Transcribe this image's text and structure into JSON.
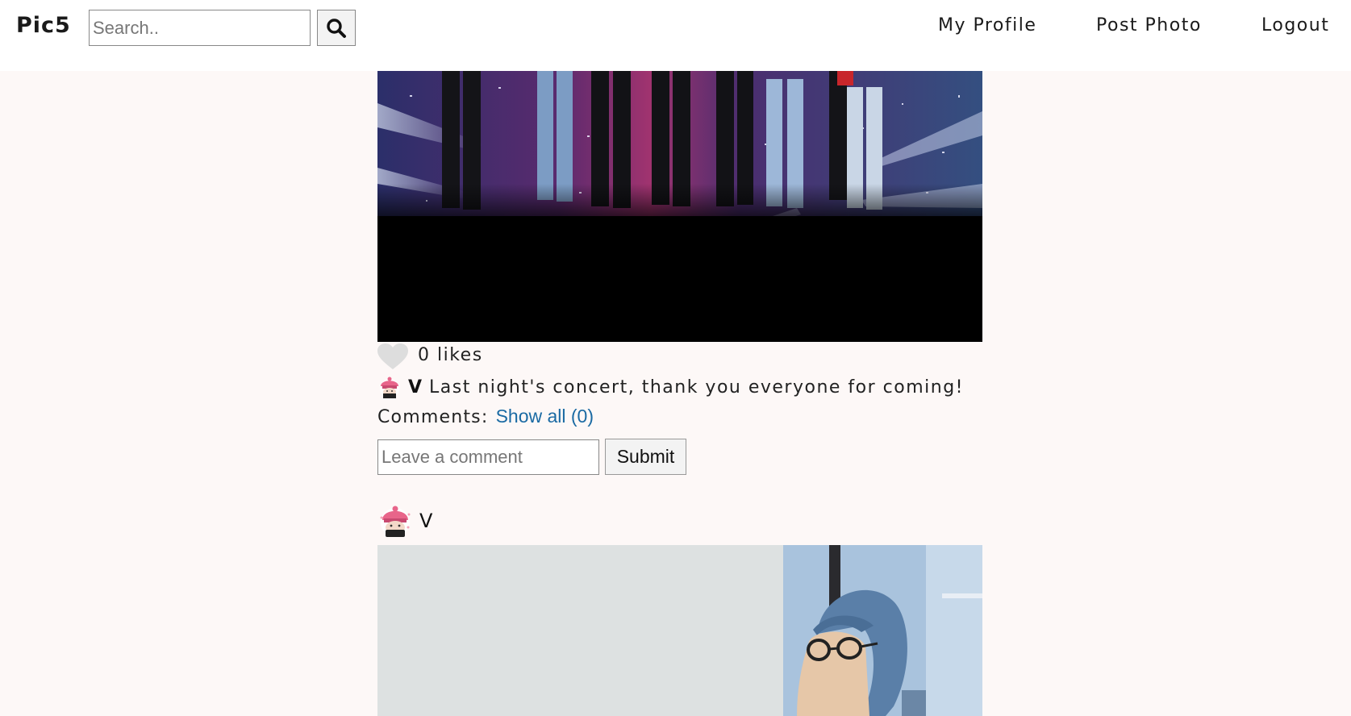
{
  "header": {
    "brand": "Pic5",
    "search_placeholder": "Search..",
    "search_icon": "search-icon",
    "nav": {
      "my_profile": "My Profile",
      "post_photo": "Post Photo",
      "logout": "Logout"
    }
  },
  "posts": [
    {
      "photo": "concert-stage-photo",
      "likes_label": "0 likes",
      "username": "V",
      "caption": "Last night's concert, thank you everyone for coming!",
      "comments_label": "Comments:",
      "show_all_label": "Show all (0)",
      "comment_placeholder": "Leave a comment",
      "submit_label": "Submit"
    },
    {
      "username": "V",
      "photo": "person-in-cap-photo"
    }
  ],
  "colors": {
    "page_bg": "#fdf8f7",
    "header_bg": "#ffffff",
    "link": "#1a6aa3",
    "heart": "#dddddd"
  }
}
